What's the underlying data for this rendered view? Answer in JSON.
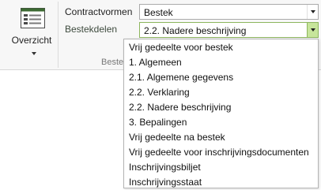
{
  "ribbon": {
    "overzicht_label": "Overzicht",
    "group_label": "Beste",
    "contractvormen_label": "Contractvormen",
    "contractvormen_value": "Bestek",
    "bestekdelen_label": "Bestekdelen",
    "bestekdelen_value": "2.2. Nadere beschrijving"
  },
  "dropdown": {
    "items": [
      "Vrij gedeelte voor bestek",
      "1. Algemeen",
      "2.1. Algemene gegevens",
      "2.2. Verklaring",
      "2.2. Nadere beschrijving",
      "3. Bepalingen",
      "Vrij gedeelte na bestek",
      "Vrij gedeelte voor inschrijvingsdocumenten",
      "Inschrijvingsbiljet",
      "Inschrijvingsstaat"
    ]
  },
  "colors": {
    "highlight_border": "#8db65e",
    "highlight_button": "#c7e59b",
    "icon_accent": "#3c6a32"
  }
}
